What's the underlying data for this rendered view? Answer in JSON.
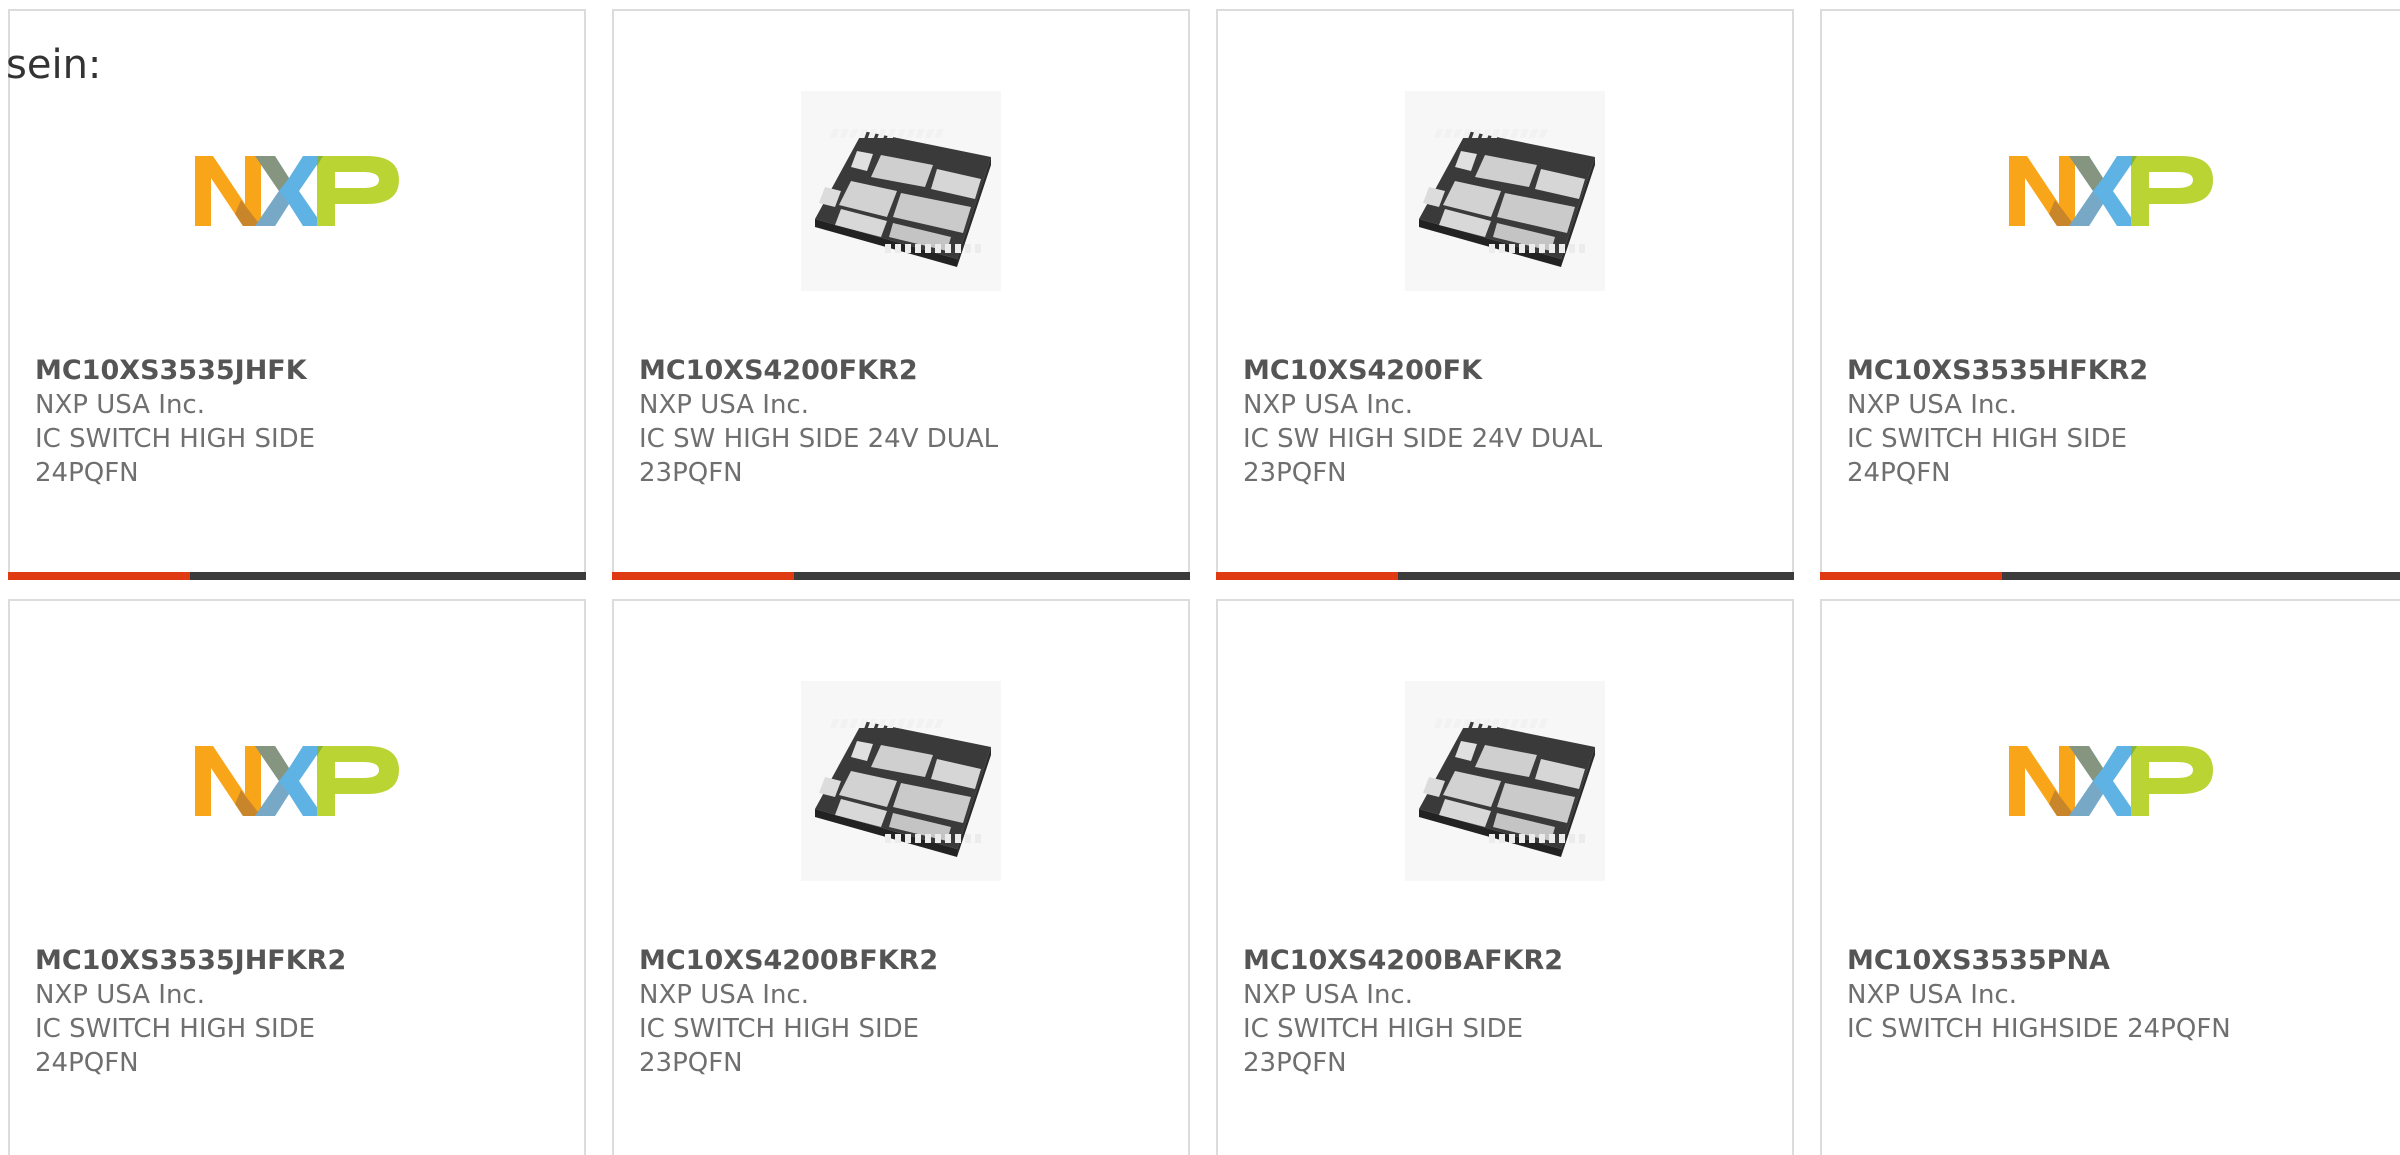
{
  "intro_text": "sein:",
  "colors": {
    "accent": "#e03a12",
    "bar": "#3c3c3c",
    "nxp_orange": "#f9a51a",
    "nxp_blue": "#5fb3e4",
    "nxp_green": "#b9d433"
  },
  "products": [
    {
      "part": "MC10XS3535JHFK",
      "manufacturer": "NXP USA Inc.",
      "description": "IC SWITCH HIGH SIDE 24PQFN",
      "image": "nxp-logo"
    },
    {
      "part": "MC10XS4200FKR2",
      "manufacturer": "NXP USA Inc.",
      "description": "IC SW HIGH SIDE 24V DUAL 23PQFN",
      "image": "chip-package"
    },
    {
      "part": "MC10XS4200FK",
      "manufacturer": "NXP USA Inc.",
      "description": "IC SW HIGH SIDE 24V DUAL 23PQFN",
      "image": "chip-package"
    },
    {
      "part": "MC10XS3535HFKR2",
      "manufacturer": "NXP USA Inc.",
      "description": "IC SWITCH HIGH SIDE 24PQFN",
      "image": "nxp-logo"
    },
    {
      "part": "MC10XS3535JHFKR2",
      "manufacturer": "NXP USA Inc.",
      "description": "IC SWITCH HIGH SIDE 24PQFN",
      "image": "nxp-logo"
    },
    {
      "part": "MC10XS4200BFKR2",
      "manufacturer": "NXP USA Inc.",
      "description": "IC SWITCH HIGH SIDE 23PQFN",
      "image": "chip-package"
    },
    {
      "part": "MC10XS4200BAFKR2",
      "manufacturer": "NXP USA Inc.",
      "description": "IC SWITCH HIGH SIDE 23PQFN",
      "image": "chip-package"
    },
    {
      "part": "MC10XS3535PNA",
      "manufacturer": "NXP USA Inc.",
      "description": "IC SWITCH HIGHSIDE 24PQFN",
      "image": "nxp-logo"
    }
  ]
}
